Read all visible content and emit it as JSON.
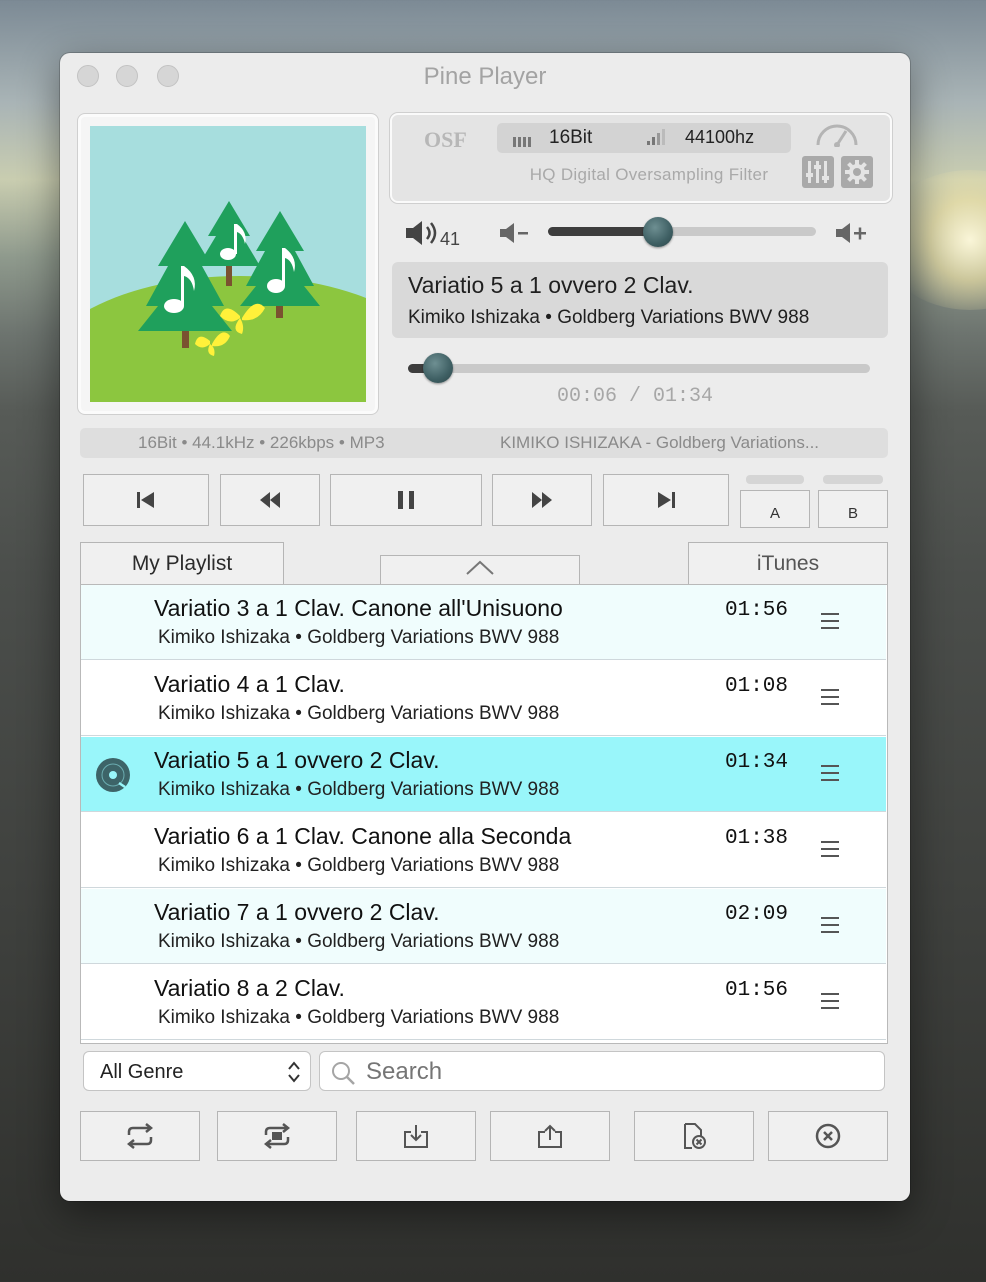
{
  "window": {
    "title": "Pine Player"
  },
  "osf": {
    "logo": "OSF",
    "bit_depth": "16Bit",
    "sample_rate": "44100hz",
    "filter_label": "HQ Digital Oversampling Filter"
  },
  "volume": {
    "level": "41",
    "value": 41,
    "max": 100
  },
  "now_playing": {
    "title": "Variatio 5 a 1 ovvero 2 Clav.",
    "subtitle": "Kimiko Ishizaka • Goldberg Variations BWV 988",
    "progress_fraction": 0.066,
    "time": "00:06 / 01:34"
  },
  "info_bar": {
    "format": "16Bit • 44.1kHz • 226kbps • MP3",
    "track": "KIMIKO ISHIZAKA - Goldberg Variations..."
  },
  "transport": {
    "loop_a": "A",
    "loop_b": "B"
  },
  "tabs": {
    "left": "My Playlist",
    "right": "iTunes"
  },
  "playlist": [
    {
      "title": "Variatio 3 a 1 Clav. Canone all'Unisuono",
      "subtitle": "Kimiko Ishizaka • Goldberg Variations BWV 988",
      "duration": "01:56",
      "playing": false
    },
    {
      "title": "Variatio 4 a 1 Clav.",
      "subtitle": "Kimiko Ishizaka • Goldberg Variations BWV 988",
      "duration": "01:08",
      "playing": false
    },
    {
      "title": "Variatio 5 a 1 ovvero 2 Clav.",
      "subtitle": "Kimiko Ishizaka • Goldberg Variations BWV 988",
      "duration": "01:34",
      "playing": true
    },
    {
      "title": "Variatio 6 a 1 Clav. Canone alla Seconda",
      "subtitle": "Kimiko Ishizaka • Goldberg Variations BWV 988",
      "duration": "01:38",
      "playing": false
    },
    {
      "title": "Variatio 7 a 1 ovvero 2 Clav.",
      "subtitle": "Kimiko Ishizaka • Goldberg Variations BWV 988",
      "duration": "02:09",
      "playing": false
    },
    {
      "title": "Variatio 8 a 2 Clav.",
      "subtitle": "Kimiko Ishizaka • Goldberg Variations BWV 988",
      "duration": "01:56",
      "playing": false
    }
  ],
  "filters": {
    "genre_selected": "All Genre",
    "search_placeholder": "Search"
  },
  "colors": {
    "row_alt": "#f0fdfd",
    "row_playing": "#99f6fa",
    "knob": "#3e5f63"
  }
}
